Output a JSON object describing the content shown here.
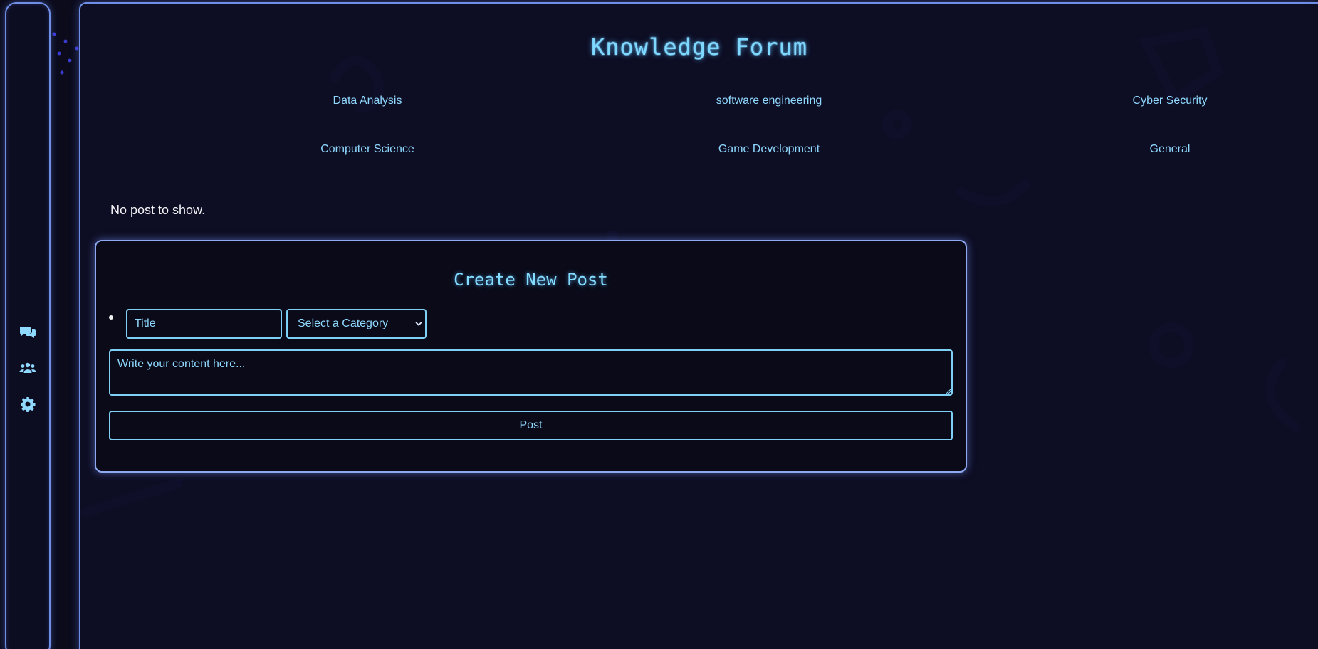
{
  "page": {
    "title": "Knowledge Forum",
    "empty_message": "No post to show."
  },
  "categories": [
    "Data Analysis",
    "software engineering",
    "Cyber Security",
    "Computer Science",
    "Game Development",
    "General"
  ],
  "sidebar": {
    "icons": [
      "chat-icon",
      "users-icon",
      "gear-icon"
    ]
  },
  "create_post": {
    "heading": "Create New Post",
    "title_placeholder": "Title",
    "category_selected": "Select a Category",
    "content_placeholder": "Write your content here...",
    "submit_label": "Post"
  },
  "colors": {
    "accent": "#7fd8ff",
    "border": "#6f8fe6",
    "background": "#0b0b1c"
  }
}
